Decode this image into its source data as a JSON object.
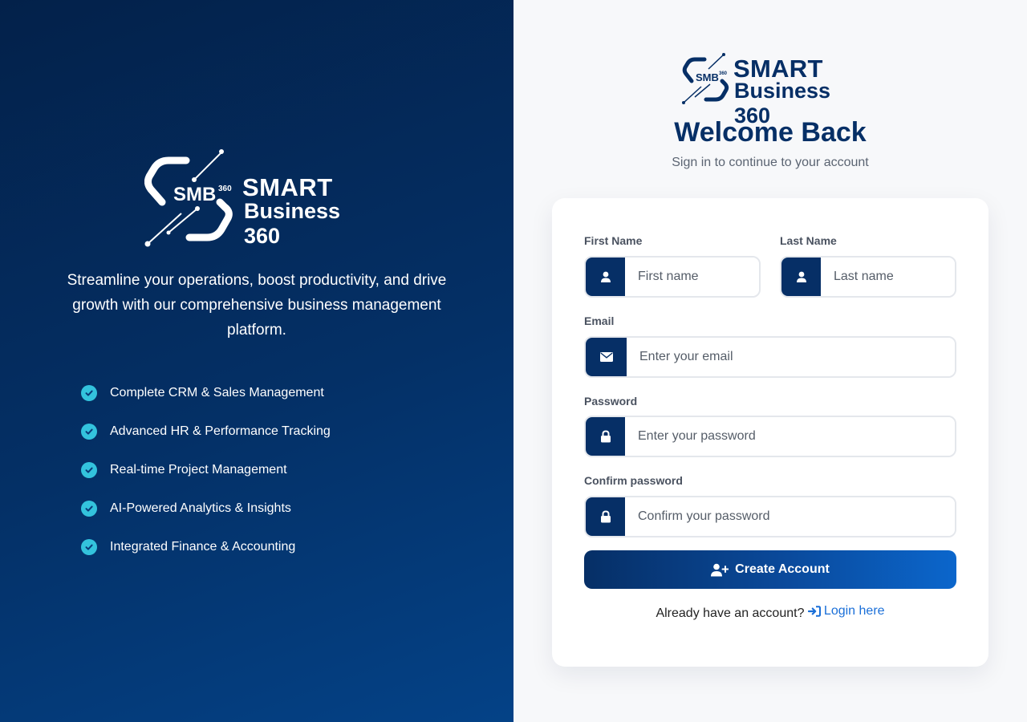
{
  "brand": {
    "monogram": "SMB",
    "monogram_sup": "360",
    "line1": "SMART",
    "line2": "Business 360"
  },
  "left": {
    "tagline": "Streamline your operations, boost productivity, and drive growth with our comprehensive business management platform.",
    "features": [
      "Complete CRM & Sales Management",
      "Advanced HR & Performance Tracking",
      "Real-time Project Management",
      "AI-Powered Analytics & Insights",
      "Integrated Finance & Accounting"
    ]
  },
  "right": {
    "title": "Welcome Back",
    "subtitle": "Sign in to continue to your account"
  },
  "form": {
    "first_name": {
      "label": "First Name",
      "placeholder": "First name",
      "value": ""
    },
    "last_name": {
      "label": "Last Name",
      "placeholder": "Last name",
      "value": ""
    },
    "email": {
      "label": "Email",
      "placeholder": "Enter your email",
      "value": ""
    },
    "password": {
      "label": "Password",
      "placeholder": "Enter your password",
      "value": ""
    },
    "confirm_password": {
      "label": "Confirm password",
      "placeholder": "Confirm your password",
      "value": ""
    },
    "submit_label": "Create Account",
    "login_prompt": "Already have an account?",
    "login_link": "Login here"
  },
  "colors": {
    "navy": "#062f66",
    "accent_check": "#33c3dd",
    "link": "#1a6fd8",
    "button_gradient_end": "#0b66cc"
  },
  "icons": {
    "feature": "check-circle-icon",
    "name_fields": "user-icon",
    "email": "envelope-icon",
    "password": "lock-icon",
    "submit": "user-plus-icon",
    "login": "sign-in-icon"
  }
}
